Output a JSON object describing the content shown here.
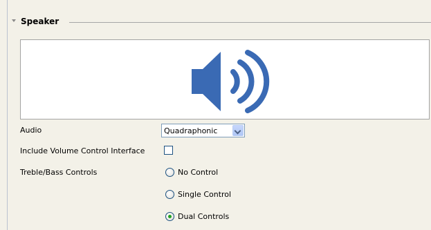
{
  "section": {
    "title": "Speaker"
  },
  "image": {
    "icon": "speaker-volume-icon",
    "color": "#3a6ab4"
  },
  "form": {
    "audio": {
      "label": "Audio",
      "selected": "Quadraphonic"
    },
    "volume": {
      "label": "Include Volume Control Interface",
      "checked": false
    },
    "treble_bass": {
      "label": "Treble/Bass Controls",
      "options": [
        "No Control",
        "Single Control",
        "Dual Controls"
      ],
      "selected_index": 2
    }
  }
}
